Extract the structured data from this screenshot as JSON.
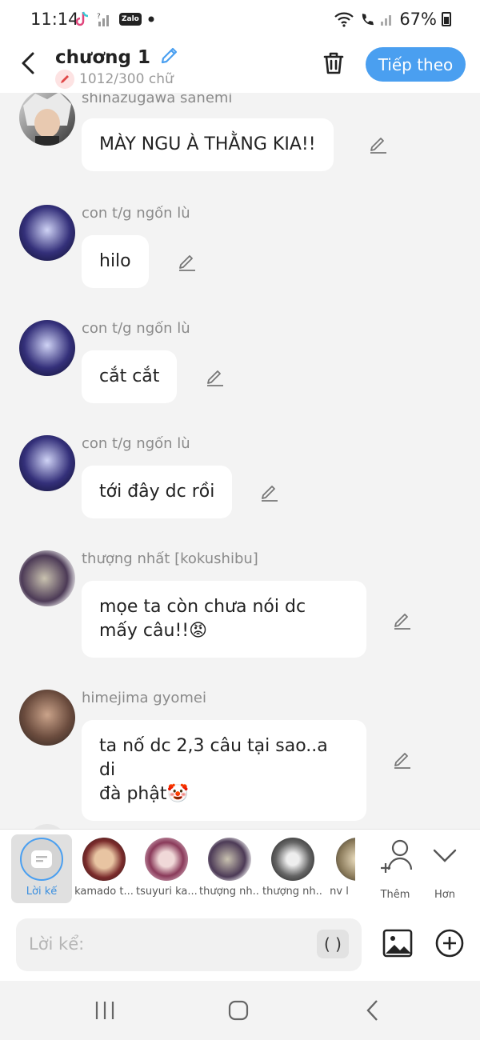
{
  "status": {
    "time": "11:14",
    "battery": "67%",
    "zalo": "Zalo"
  },
  "header": {
    "title": "chương 1",
    "count": "1012/300 chữ",
    "next_label": "Tiếp theo"
  },
  "messages": [
    {
      "name": "shinazugawa sanemi",
      "text": "MÀY NGU À THẰNG KIA!!"
    },
    {
      "name": "con t/g ngốn lù",
      "text": "hilo"
    },
    {
      "name": "con t/g ngốn lù",
      "text": "cắt cắt"
    },
    {
      "name": "con t/g ngốn lù",
      "text": "tới đây dc rồi"
    },
    {
      "name": "thượng nhất [kokushibu]",
      "text": "mọe ta còn chưa nói dc\nmấy câu!!😡"
    },
    {
      "name": "himejima gyomei",
      "text": "ta nố dc 2,3 câu tại sao..a di\nđà phật🤡"
    }
  ],
  "characters": [
    {
      "label": "Lời kể",
      "selected": true
    },
    {
      "label": "kamado t..."
    },
    {
      "label": "tsuyuri ka..."
    },
    {
      "label": "thượng nh..."
    },
    {
      "label": "thượng nh..."
    },
    {
      "label": "nv l"
    }
  ],
  "actions": {
    "more_label": "Thêm",
    "less_label": "Hơn"
  },
  "input": {
    "placeholder": "Lời kể:",
    "paren": "( )"
  }
}
